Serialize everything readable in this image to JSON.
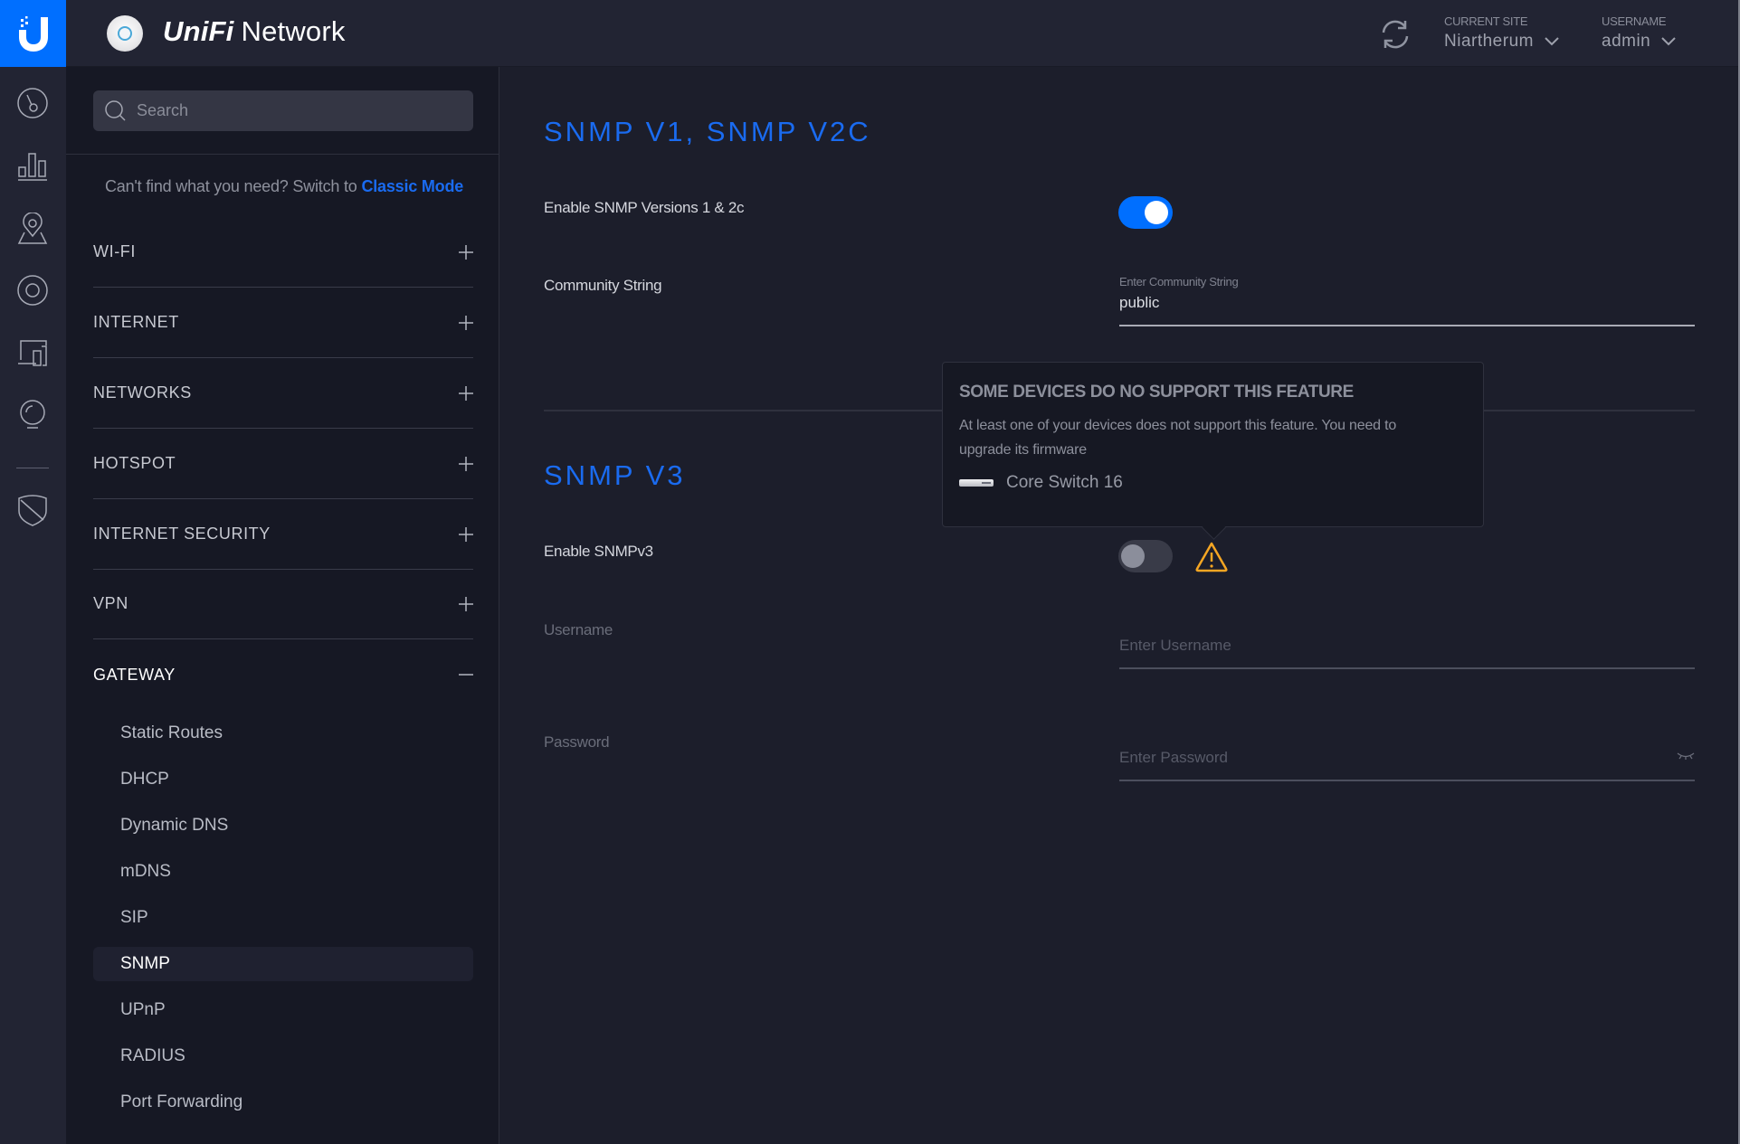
{
  "header": {
    "app_brand": "UniFi",
    "app_name": "Network",
    "current_site_label": "CURRENT SITE",
    "current_site_value": "Niartherum",
    "username_label": "USERNAME",
    "username_value": "admin"
  },
  "rail": {
    "icons": [
      "dashboard-icon",
      "statistics-icon",
      "map-icon",
      "devices-icon",
      "clients-icon",
      "insights-icon",
      "threat-management-icon"
    ]
  },
  "sidebar": {
    "search_placeholder": "Search",
    "classic_prompt": "Can't find what you need? Switch to",
    "classic_link": "Classic Mode",
    "sections": [
      {
        "label": "WI-FI",
        "expanded": false
      },
      {
        "label": "INTERNET",
        "expanded": false
      },
      {
        "label": "NETWORKS",
        "expanded": false
      },
      {
        "label": "HOTSPOT",
        "expanded": false
      },
      {
        "label": "INTERNET SECURITY",
        "expanded": false
      },
      {
        "label": "VPN",
        "expanded": false
      },
      {
        "label": "GATEWAY",
        "expanded": true
      }
    ],
    "gateway_items": [
      {
        "label": "Static Routes",
        "active": false
      },
      {
        "label": "DHCP",
        "active": false
      },
      {
        "label": "Dynamic DNS",
        "active": false
      },
      {
        "label": "mDNS",
        "active": false
      },
      {
        "label": "SIP",
        "active": false
      },
      {
        "label": "SNMP",
        "active": true
      },
      {
        "label": "UPnP",
        "active": false
      },
      {
        "label": "RADIUS",
        "active": false
      },
      {
        "label": "Port Forwarding",
        "active": false
      }
    ]
  },
  "main": {
    "v1v2": {
      "title": "SNMP V1, SNMP V2C",
      "enable_label": "Enable SNMP Versions 1 & 2c",
      "enabled": true,
      "community_label": "Community String",
      "community_field_label": "Enter Community String",
      "community_value": "public"
    },
    "v3": {
      "title": "SNMP V3",
      "enable_label": "Enable SNMPv3",
      "enabled": false,
      "username_label": "Username",
      "username_placeholder": "Enter Username",
      "password_label": "Password",
      "password_placeholder": "Enter Password"
    },
    "tooltip": {
      "title": "SOME DEVICES DO NO SUPPORT THIS FEATURE",
      "text": "At least one of your devices does not support this feature. You need to upgrade its firmware",
      "device_name": "Core Switch 16"
    },
    "colors": {
      "accent": "#006fff",
      "warning": "#f5a623"
    }
  }
}
